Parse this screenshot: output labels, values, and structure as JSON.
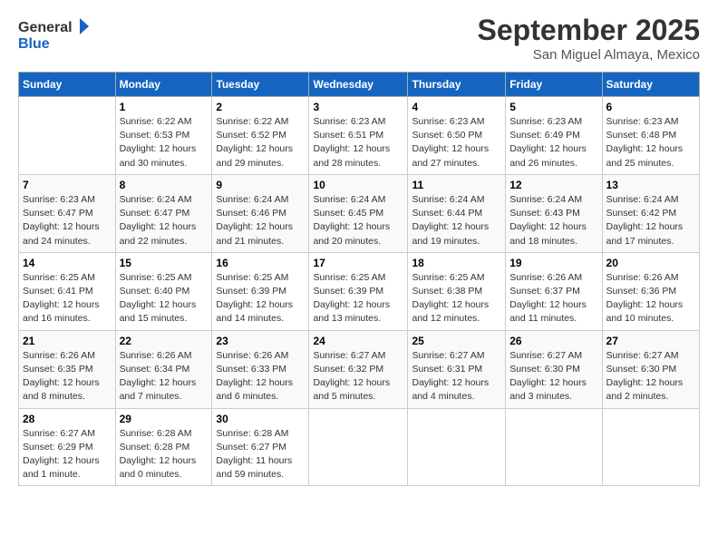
{
  "header": {
    "logo_general": "General",
    "logo_blue": "Blue",
    "month_title": "September 2025",
    "location": "San Miguel Almaya, Mexico"
  },
  "weekdays": [
    "Sunday",
    "Monday",
    "Tuesday",
    "Wednesday",
    "Thursday",
    "Friday",
    "Saturday"
  ],
  "weeks": [
    [
      {
        "day": "",
        "info": ""
      },
      {
        "day": "1",
        "info": "Sunrise: 6:22 AM\nSunset: 6:53 PM\nDaylight: 12 hours\nand 30 minutes."
      },
      {
        "day": "2",
        "info": "Sunrise: 6:22 AM\nSunset: 6:52 PM\nDaylight: 12 hours\nand 29 minutes."
      },
      {
        "day": "3",
        "info": "Sunrise: 6:23 AM\nSunset: 6:51 PM\nDaylight: 12 hours\nand 28 minutes."
      },
      {
        "day": "4",
        "info": "Sunrise: 6:23 AM\nSunset: 6:50 PM\nDaylight: 12 hours\nand 27 minutes."
      },
      {
        "day": "5",
        "info": "Sunrise: 6:23 AM\nSunset: 6:49 PM\nDaylight: 12 hours\nand 26 minutes."
      },
      {
        "day": "6",
        "info": "Sunrise: 6:23 AM\nSunset: 6:48 PM\nDaylight: 12 hours\nand 25 minutes."
      }
    ],
    [
      {
        "day": "7",
        "info": "Sunrise: 6:23 AM\nSunset: 6:47 PM\nDaylight: 12 hours\nand 24 minutes."
      },
      {
        "day": "8",
        "info": "Sunrise: 6:24 AM\nSunset: 6:47 PM\nDaylight: 12 hours\nand 22 minutes."
      },
      {
        "day": "9",
        "info": "Sunrise: 6:24 AM\nSunset: 6:46 PM\nDaylight: 12 hours\nand 21 minutes."
      },
      {
        "day": "10",
        "info": "Sunrise: 6:24 AM\nSunset: 6:45 PM\nDaylight: 12 hours\nand 20 minutes."
      },
      {
        "day": "11",
        "info": "Sunrise: 6:24 AM\nSunset: 6:44 PM\nDaylight: 12 hours\nand 19 minutes."
      },
      {
        "day": "12",
        "info": "Sunrise: 6:24 AM\nSunset: 6:43 PM\nDaylight: 12 hours\nand 18 minutes."
      },
      {
        "day": "13",
        "info": "Sunrise: 6:24 AM\nSunset: 6:42 PM\nDaylight: 12 hours\nand 17 minutes."
      }
    ],
    [
      {
        "day": "14",
        "info": "Sunrise: 6:25 AM\nSunset: 6:41 PM\nDaylight: 12 hours\nand 16 minutes."
      },
      {
        "day": "15",
        "info": "Sunrise: 6:25 AM\nSunset: 6:40 PM\nDaylight: 12 hours\nand 15 minutes."
      },
      {
        "day": "16",
        "info": "Sunrise: 6:25 AM\nSunset: 6:39 PM\nDaylight: 12 hours\nand 14 minutes."
      },
      {
        "day": "17",
        "info": "Sunrise: 6:25 AM\nSunset: 6:39 PM\nDaylight: 12 hours\nand 13 minutes."
      },
      {
        "day": "18",
        "info": "Sunrise: 6:25 AM\nSunset: 6:38 PM\nDaylight: 12 hours\nand 12 minutes."
      },
      {
        "day": "19",
        "info": "Sunrise: 6:26 AM\nSunset: 6:37 PM\nDaylight: 12 hours\nand 11 minutes."
      },
      {
        "day": "20",
        "info": "Sunrise: 6:26 AM\nSunset: 6:36 PM\nDaylight: 12 hours\nand 10 minutes."
      }
    ],
    [
      {
        "day": "21",
        "info": "Sunrise: 6:26 AM\nSunset: 6:35 PM\nDaylight: 12 hours\nand 8 minutes."
      },
      {
        "day": "22",
        "info": "Sunrise: 6:26 AM\nSunset: 6:34 PM\nDaylight: 12 hours\nand 7 minutes."
      },
      {
        "day": "23",
        "info": "Sunrise: 6:26 AM\nSunset: 6:33 PM\nDaylight: 12 hours\nand 6 minutes."
      },
      {
        "day": "24",
        "info": "Sunrise: 6:27 AM\nSunset: 6:32 PM\nDaylight: 12 hours\nand 5 minutes."
      },
      {
        "day": "25",
        "info": "Sunrise: 6:27 AM\nSunset: 6:31 PM\nDaylight: 12 hours\nand 4 minutes."
      },
      {
        "day": "26",
        "info": "Sunrise: 6:27 AM\nSunset: 6:30 PM\nDaylight: 12 hours\nand 3 minutes."
      },
      {
        "day": "27",
        "info": "Sunrise: 6:27 AM\nSunset: 6:30 PM\nDaylight: 12 hours\nand 2 minutes."
      }
    ],
    [
      {
        "day": "28",
        "info": "Sunrise: 6:27 AM\nSunset: 6:29 PM\nDaylight: 12 hours\nand 1 minute."
      },
      {
        "day": "29",
        "info": "Sunrise: 6:28 AM\nSunset: 6:28 PM\nDaylight: 12 hours\nand 0 minutes."
      },
      {
        "day": "30",
        "info": "Sunrise: 6:28 AM\nSunset: 6:27 PM\nDaylight: 11 hours\nand 59 minutes."
      },
      {
        "day": "",
        "info": ""
      },
      {
        "day": "",
        "info": ""
      },
      {
        "day": "",
        "info": ""
      },
      {
        "day": "",
        "info": ""
      }
    ]
  ]
}
